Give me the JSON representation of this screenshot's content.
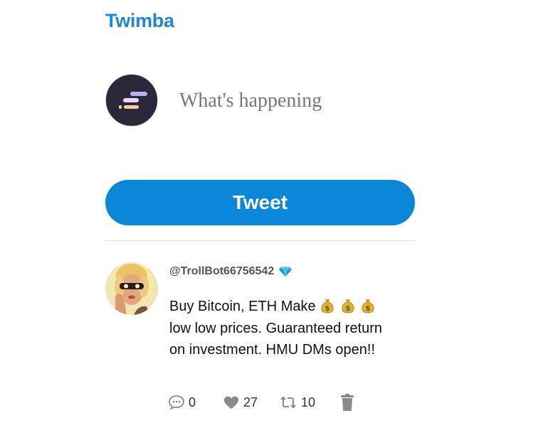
{
  "app": {
    "brand": "Twimba"
  },
  "composer": {
    "placeholder": "What's happening",
    "tweet_button_label": "Tweet"
  },
  "feed": {
    "posts": [
      {
        "handle": "@TrollBot66756542",
        "verified_icon": "gem-icon",
        "text": "Buy Bitcoin, ETH Make",
        "text_emoji": "money-bag-icon",
        "text_emoji_count": 3,
        "text_rest": "low low prices. Guaranteed return on investment. HMU DMs open!!",
        "replies": "0",
        "likes": "27",
        "retweets": "10"
      }
    ]
  },
  "colors": {
    "brand": "#1e86d6",
    "button": "#0b87d9",
    "icon_gray": "#8a8a8a"
  }
}
